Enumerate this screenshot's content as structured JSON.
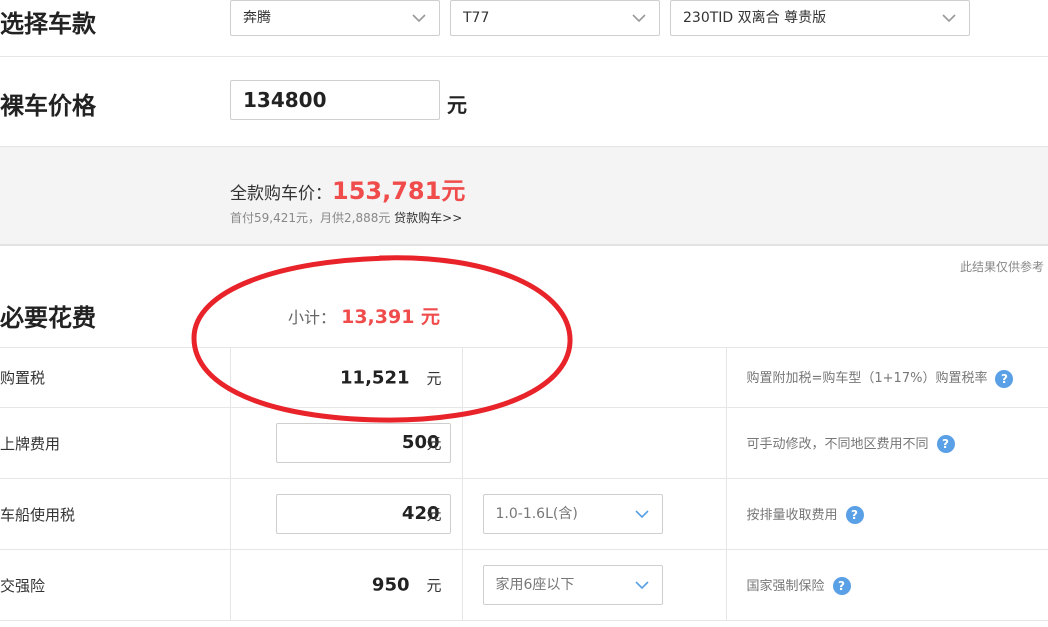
{
  "select_car": {
    "label": "选择车款",
    "brand": "奔腾",
    "model": "T77",
    "version": "230TID 双离合 尊贵版"
  },
  "bare_price": {
    "label": "裸车价格",
    "value": "134800",
    "unit": "元"
  },
  "summary": {
    "total_label": "全款购车价：",
    "total_value": "153,781元",
    "loan_text": "首付59,421元，月供2,888元",
    "loan_link": "贷款购车>>"
  },
  "note": "此结果仅供参考",
  "required": {
    "label": "必要花费",
    "subtotal_label": "小计：",
    "subtotal_value": "13,391 元",
    "rows": [
      {
        "name": "购置税",
        "amount": "11,521",
        "unit": "元",
        "editable": false,
        "option": "",
        "desc": "购置附加税=购车型（1+17%）购置税率"
      },
      {
        "name": "上牌费用",
        "amount": "500",
        "unit": "元",
        "editable": true,
        "option": "",
        "desc": "可手动修改，不同地区费用不同"
      },
      {
        "name": "车船使用税",
        "amount": "420",
        "unit": "元",
        "editable": true,
        "option": "1.0-1.6L(含)",
        "desc": "按排量收取费用"
      },
      {
        "name": "交强险",
        "amount": "950",
        "unit": "元",
        "editable": false,
        "option": "家用6座以下",
        "desc": "国家强制保险"
      }
    ]
  },
  "icons": {
    "dropdown": "chevron-down-icon",
    "help": "question-mark-icon",
    "help_glyph": "?"
  },
  "colors": {
    "accent_red": "#f04c4c",
    "help_blue": "#5aa0e6",
    "annotation_red": "#e8232a"
  }
}
